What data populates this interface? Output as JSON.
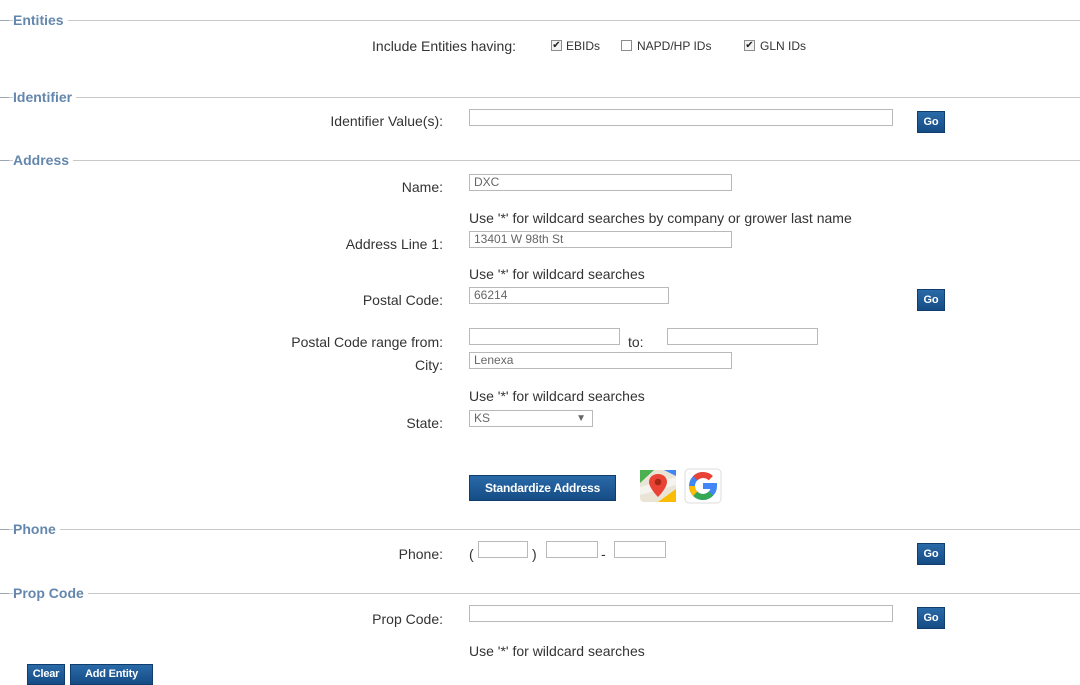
{
  "sections": {
    "entities": "Entities",
    "identifier": "Identifier",
    "address": "Address",
    "phone": "Phone",
    "prop_code": "Prop Code"
  },
  "entities": {
    "include_label": "Include Entities having:",
    "options": [
      {
        "label": "EBIDs",
        "checked": true
      },
      {
        "label": "NAPD/HP IDs",
        "checked": false
      },
      {
        "label": "GLN IDs",
        "checked": true
      }
    ]
  },
  "identifier": {
    "label": "Identifier Value(s):",
    "value": "",
    "go": "Go"
  },
  "address": {
    "name_label": "Name:",
    "name_value": "DXC",
    "name_hint": "Use '*' for wildcard searches by company or grower last name",
    "line1_label": "Address Line 1:",
    "line1_value": "13401 W 98th St",
    "line1_hint": "Use '*' for wildcard searches",
    "postal_label": "Postal Code:",
    "postal_value": "66214",
    "go": "Go",
    "range_label": "Postal Code range from:",
    "range_to": "to:",
    "city_label": "City:",
    "city_value": "Lenexa",
    "city_hint": "Use '*' for wildcard searches",
    "state_label": "State:",
    "state_value": "KS",
    "standardize_button": "Standardize Address"
  },
  "phone": {
    "label": "Phone:",
    "open_paren": "(",
    "close_paren": ")",
    "dash": "-",
    "go": "Go"
  },
  "prop_code": {
    "label": "Prop Code:",
    "go": "Go",
    "hint": "Use '*' for wildcard searches"
  },
  "footer": {
    "clear": "Clear",
    "add_entity": "Add Entity"
  },
  "colors": {
    "section_title": "#6487ad",
    "button": "#1b5894"
  }
}
